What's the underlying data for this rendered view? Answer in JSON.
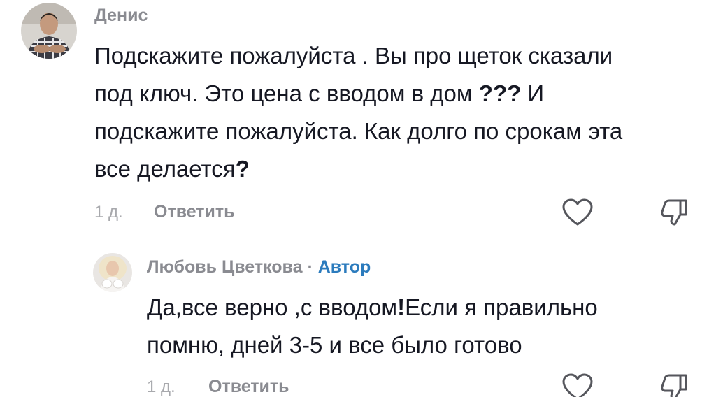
{
  "comment": {
    "username": "Денис",
    "text_line_1": "Подскажите пожалуйста . Вы про щеток сказали",
    "text_line_2_a": "под ключ. Это цена с вводом в дом ",
    "text_line_2_b": "???",
    "text_line_2_c": " И",
    "text_line_3": "подскажите пожалуйста. Как долго по срокам эта",
    "text_line_4_a": "все делается",
    "text_line_4_b": "?",
    "time": "1 д.",
    "reply_label": "Ответить"
  },
  "reply": {
    "username": "Любовь Цветкова",
    "separator": "·",
    "author_badge": "Автор",
    "text_line_1_a": "Да,все верно ,с вводом",
    "text_line_1_b": "!",
    "text_line_1_c": "Если я правильно",
    "text_line_2_a": "помню, дней ",
    "text_line_2_b": "3-5",
    "text_line_2_c": " и все было готово",
    "time": "1 д.",
    "reply_label": "Ответить"
  },
  "icons": {
    "like": "heart-outline-icon",
    "dislike": "thumbs-down-outline-icon"
  },
  "colors": {
    "username": "#8a8b91",
    "author_badge": "#2b7bbd",
    "text": "#161823",
    "time": "#a8a9ad"
  }
}
